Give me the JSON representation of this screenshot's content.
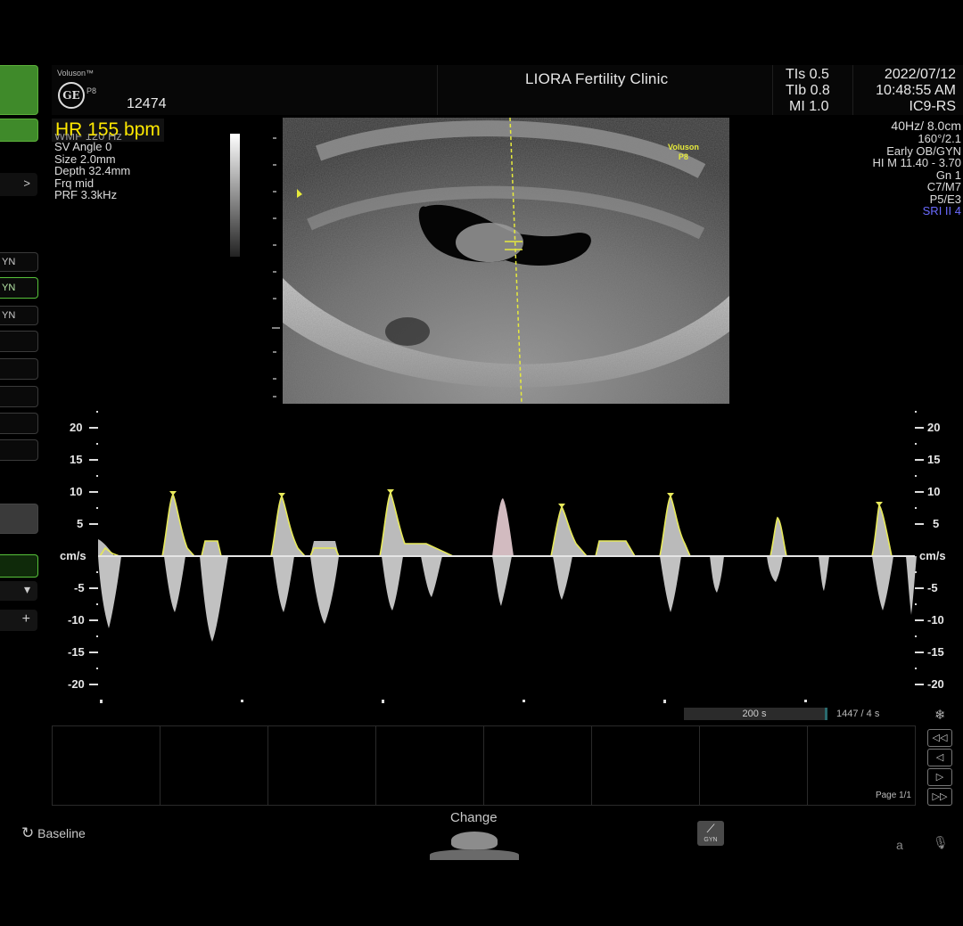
{
  "header": {
    "brand": "Voluson™",
    "model": "P8",
    "logo": "GE",
    "patient_id": "12474",
    "clinic": "LIORA Fertility Clinic",
    "tis": "TIs 0.5",
    "tib": "TIb 0.8",
    "mi": "MI 1.0",
    "date": "2022/07/12",
    "time": "10:48:55 AM",
    "probe": "IC9-RS"
  },
  "hr_label": "HR 155 bpm",
  "doppler_params": [
    "WMF 120 Hz",
    "SV Angle  0",
    "Size  2.0mm",
    "Depth 32.4mm",
    "Frq mid",
    "PRF  3.3kHz"
  ],
  "image_params": [
    "40Hz/ 8.0cm",
    "160°/2.1",
    "Early OB/GYN",
    "HI M  11.40 - 3.70",
    "Gn  1",
    "C7/M7",
    "P5/E3"
  ],
  "sri_label": "SRI II 4",
  "image_watermark": {
    "brand": "Voluson",
    "model": "P8"
  },
  "sidebar": {
    "items": [
      {
        "label": ""
      },
      {
        "label": ""
      },
      {
        "label": ">"
      },
      {
        "label": "YN"
      },
      {
        "label": "YN"
      },
      {
        "label": "YN"
      },
      {
        "label": "-"
      },
      {
        "label": "+"
      }
    ]
  },
  "doppler_axis": {
    "unit": "cm/s",
    "ticks_left": [
      "20",
      "15",
      "10",
      "5",
      "cm/s",
      "-5",
      "-10",
      "-15",
      "-20"
    ],
    "ticks_right": [
      "20",
      "15",
      "10",
      "5",
      "cm/s",
      "-5",
      "-10",
      "-15",
      "-20"
    ]
  },
  "cine": {
    "time_label": "200 s",
    "frame_label": "1447 / 4 s",
    "page_label": "Page 1/1"
  },
  "bottom": {
    "baseline_label": "Baseline",
    "change_label": "Change",
    "gyn_label": "GYN",
    "a_label": "a"
  },
  "colors": {
    "accent_green": "#3f8a2a",
    "hr_yellow": "#ffe900",
    "sri_blue": "#5b5bff",
    "trace_yellow": "#e7e95a"
  }
}
